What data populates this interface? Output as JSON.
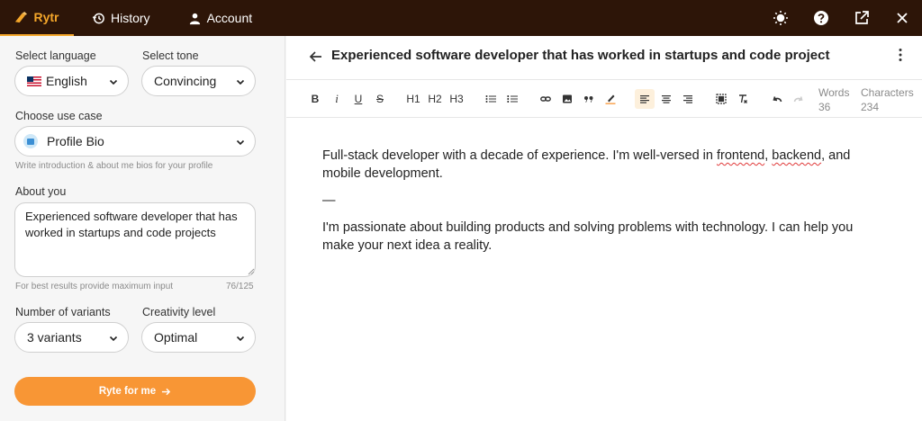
{
  "topbar": {
    "brand": "Rytr",
    "history": "History",
    "account": "Account",
    "icons": [
      "sun-icon",
      "help-icon",
      "external-link-icon",
      "close-icon"
    ]
  },
  "left": {
    "language_label": "Select language",
    "language_value": "English",
    "tone_label": "Select tone",
    "tone_value": "Convincing",
    "usecase_label": "Choose use case",
    "usecase_value": "Profile Bio",
    "usecase_hint": "Write introduction & about me bios for your profile",
    "about_label": "About you",
    "about_value": "Experienced software developer that has worked in startups and code projects",
    "about_hint": "For best results provide maximum input",
    "about_count": "76/125",
    "variants_label": "Number of variants",
    "variants_value": "3 variants",
    "creativity_label": "Creativity level",
    "creativity_value": "Optimal",
    "ryte_button": "Ryte for me"
  },
  "editor": {
    "title": "Experienced software developer that has worked in startups and code project",
    "toolbar": {
      "bold": "B",
      "italic": "i",
      "underline": "U",
      "strike": "S",
      "h1": "H1",
      "h2": "H2",
      "h3": "H3"
    },
    "words_label": "Words",
    "words_value": "36",
    "chars_label": "Characters",
    "chars_value": "234",
    "para1_a": "Full-stack developer with a decade of experience. I'm well-versed in ",
    "para1_frontend": "frontend",
    "para1_sep": ", ",
    "para1_backend": "backend",
    "para1_b": ", and mobile development.",
    "divider": "—",
    "para2": "I'm passionate about building products and solving problems with technology. I can help you make your next idea a reality."
  },
  "colors": {
    "topbar_bg": "#2d1508",
    "accent": "#f89635",
    "brand": "#f4a62a"
  }
}
